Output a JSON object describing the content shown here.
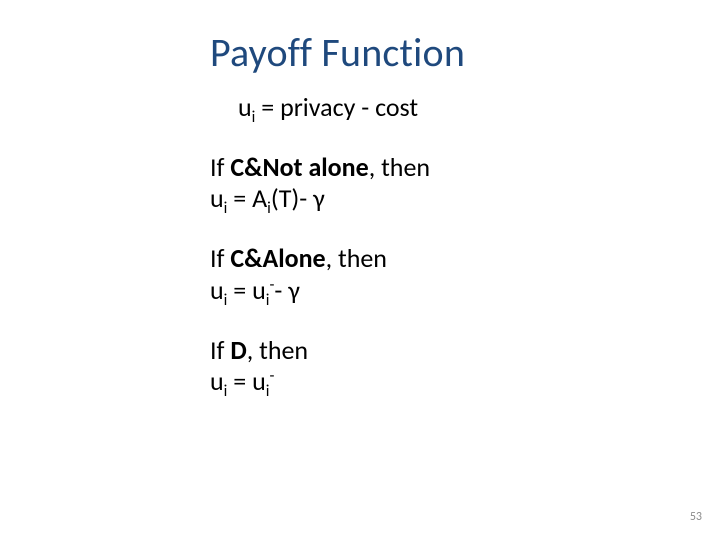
{
  "title": "Payoff Function",
  "eq_main_lhs": "u",
  "eq_main_sub": "i",
  "eq_main_rhs": " = privacy - cost",
  "case1_if": "If ",
  "case1_cond": "C&Not alone",
  "then_text": ", then",
  "case1_lhs": "u",
  "case1_sub": "i",
  "case1_mid": " = A",
  "case1_sub2": "i",
  "case1_tail": "(T)- γ",
  "case2_if": "If ",
  "case2_cond": "C&Alone",
  "case2_lhs": "u",
  "case2_sub": "i",
  "case2_mid": " = u",
  "case2_sub2": "i",
  "case2_sup": "-",
  "case2_tail": "- γ",
  "case3_if": "If ",
  "case3_cond": "D",
  "case3_lhs": "u",
  "case3_sub": "i",
  "case3_mid": " = u",
  "case3_sub2": "i",
  "case3_sup": "-",
  "page_number": "53"
}
